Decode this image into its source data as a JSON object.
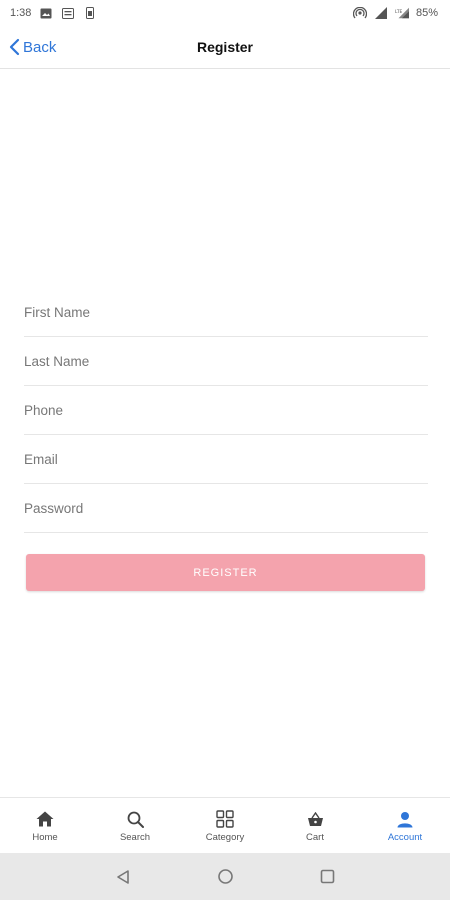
{
  "status_bar": {
    "time": "1:38",
    "battery": "85%",
    "left_icons": [
      "image-icon",
      "message-icon",
      "sim-icon"
    ],
    "right_icons": [
      "hotspot-icon",
      "signal-icon",
      "lte-signal-icon"
    ]
  },
  "header": {
    "back_label": "Back",
    "title": "Register"
  },
  "form": {
    "first_name": {
      "placeholder": "First Name",
      "value": ""
    },
    "last_name": {
      "placeholder": "Last Name",
      "value": ""
    },
    "phone": {
      "placeholder": "Phone",
      "value": ""
    },
    "email": {
      "placeholder": "Email",
      "value": ""
    },
    "password": {
      "placeholder": "Password",
      "value": ""
    },
    "submit_label": "REGISTER"
  },
  "bottom_nav": {
    "items": [
      {
        "label": "Home",
        "icon": "home-icon"
      },
      {
        "label": "Search",
        "icon": "search-icon"
      },
      {
        "label": "Category",
        "icon": "grid-icon"
      },
      {
        "label": "Cart",
        "icon": "basket-icon"
      },
      {
        "label": "Account",
        "icon": "person-icon"
      }
    ],
    "active": "Account"
  },
  "colors": {
    "accent": "#2f76d8",
    "button": "#f4a3ad",
    "divider": "#e6e6e6"
  }
}
